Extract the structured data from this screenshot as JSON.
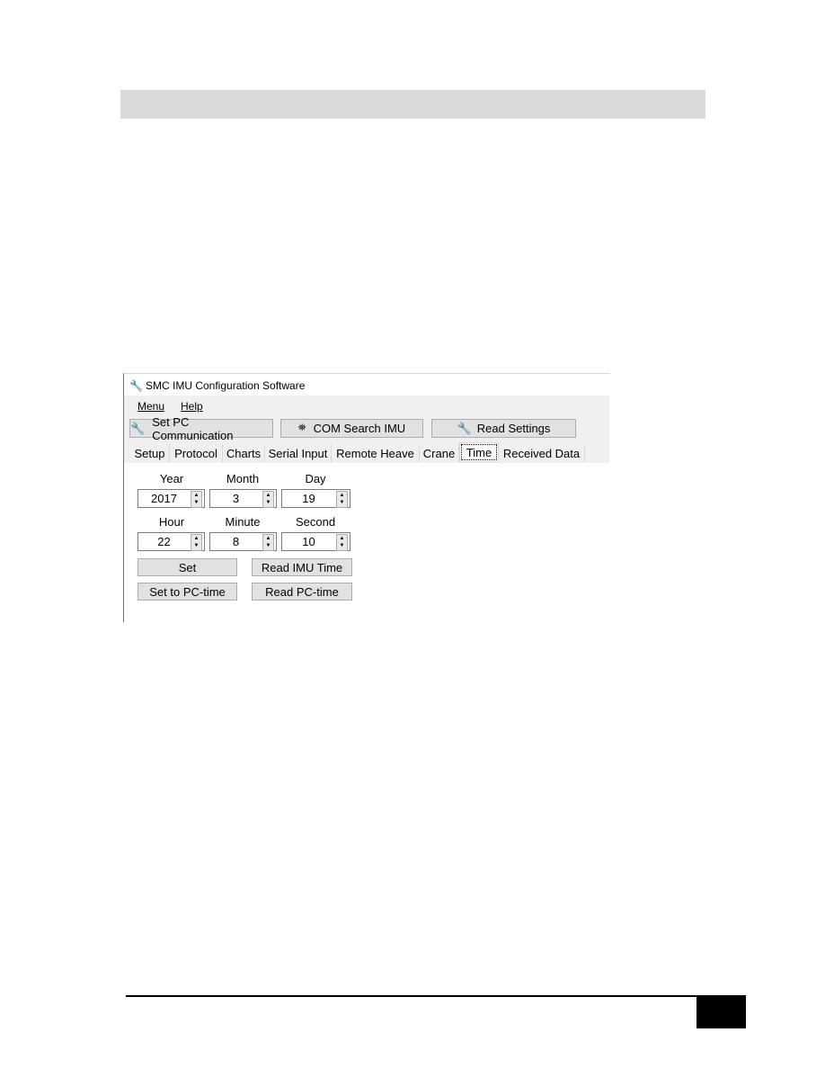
{
  "window": {
    "title": "SMC IMU Configuration Software"
  },
  "menu": [
    {
      "label": "Menu"
    },
    {
      "label": "Help"
    }
  ],
  "toolbar": {
    "set_pc_communication": "Set PC Communication",
    "com_search_imu": "COM Search IMU",
    "read_settings": "Read Settings"
  },
  "tabs": [
    {
      "label": "Setup"
    },
    {
      "label": "Protocol"
    },
    {
      "label": "Charts"
    },
    {
      "label": "Serial Input"
    },
    {
      "label": "Remote Heave"
    },
    {
      "label": "Crane"
    },
    {
      "label": "Time",
      "selected": true
    },
    {
      "label": "Received Data"
    }
  ],
  "time": {
    "labels": {
      "year": "Year",
      "month": "Month",
      "day": "Day",
      "hour": "Hour",
      "minute": "Minute",
      "second": "Second"
    },
    "values": {
      "year": "2017",
      "month": "3",
      "day": "19",
      "hour": "22",
      "minute": "8",
      "second": "10"
    },
    "buttons": {
      "set": "Set",
      "read_imu_time": "Read IMU Time",
      "set_to_pc_time": "Set to PC-time",
      "read_pc_time": "Read PC-time"
    }
  }
}
